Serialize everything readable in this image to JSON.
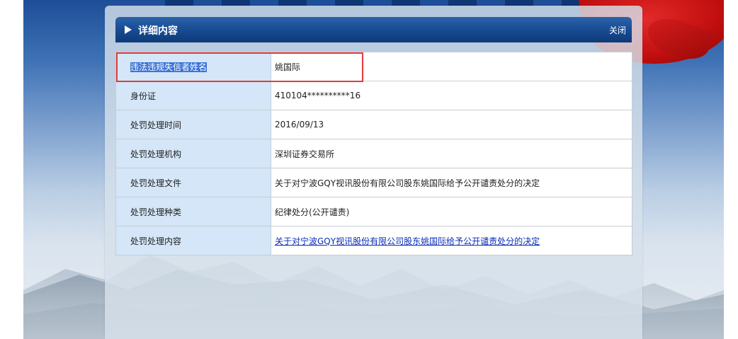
{
  "dialog": {
    "title": "详细内容",
    "close_label": "关闭"
  },
  "rows": [
    {
      "label": "违法违规失信者姓名",
      "value": "姚国际"
    },
    {
      "label": "身份证",
      "value": "410104**********16"
    },
    {
      "label": "处罚处理时间",
      "value": "2016/09/13"
    },
    {
      "label": "处罚处理机构",
      "value": "深圳证券交易所"
    },
    {
      "label": "处罚处理文件",
      "value": "关于对宁波GQY视讯股份有限公司股东姚国际给予公开谴责处分的决定"
    },
    {
      "label": "处罚处理种类",
      "value": "纪律处分(公开谴责)"
    },
    {
      "label": "处罚处理内容",
      "value": "关于对宁波GQY视讯股份有限公司股东姚国际给予公开谴责处分的决定"
    }
  ],
  "colors": {
    "title_bar": "#164a90",
    "label_cell": "#d4e6f7",
    "highlight_box": "#e23c3c",
    "link": "#0a2db8"
  },
  "icons": [
    "arrow-right-icon"
  ]
}
